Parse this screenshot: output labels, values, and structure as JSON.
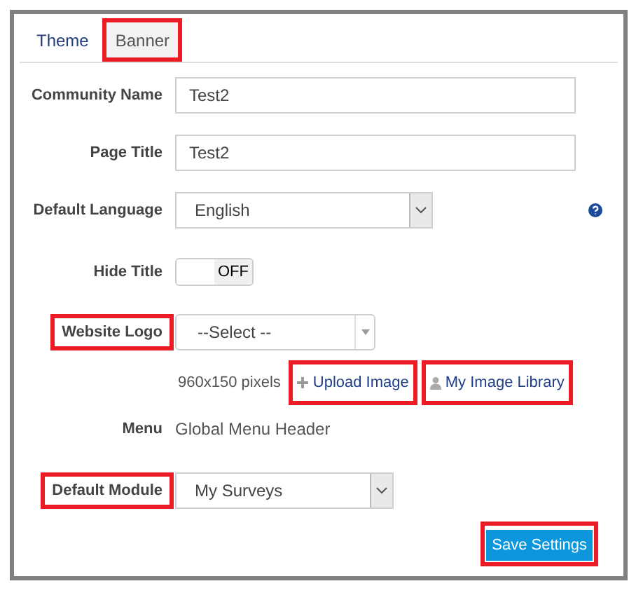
{
  "tabs": [
    {
      "label": "Theme",
      "selected": false,
      "highlighted": false
    },
    {
      "label": "Banner",
      "selected": true,
      "highlighted": true
    }
  ],
  "fields": [
    {
      "kind": "text",
      "label": "Community Name",
      "value": "Test2",
      "highlighted": false
    },
    {
      "kind": "text",
      "label": "Page Title",
      "value": "Test2",
      "highlighted": false
    },
    {
      "kind": "select",
      "label": "Default Language",
      "value": "English",
      "highlighted": false,
      "help": true
    },
    {
      "kind": "toggle",
      "label": "Hide Title",
      "on": false,
      "state_label": "OFF",
      "highlighted": false
    },
    {
      "kind": "dropdown",
      "label": "Website Logo",
      "value": "--Select --",
      "highlighted": true,
      "hint": "960x150 pixels",
      "links": [
        {
          "kind": "upload",
          "label": "Upload Image",
          "highlighted": true
        },
        {
          "kind": "library",
          "label": "My Image Library",
          "highlighted": true
        }
      ]
    },
    {
      "kind": "static",
      "label": "Menu",
      "value": "Global Menu Header",
      "highlighted": false
    },
    {
      "kind": "select",
      "label": "Default Module",
      "value": "My Surveys",
      "highlighted": true
    }
  ],
  "save_button": {
    "label": "Save Settings",
    "highlighted": true
  }
}
